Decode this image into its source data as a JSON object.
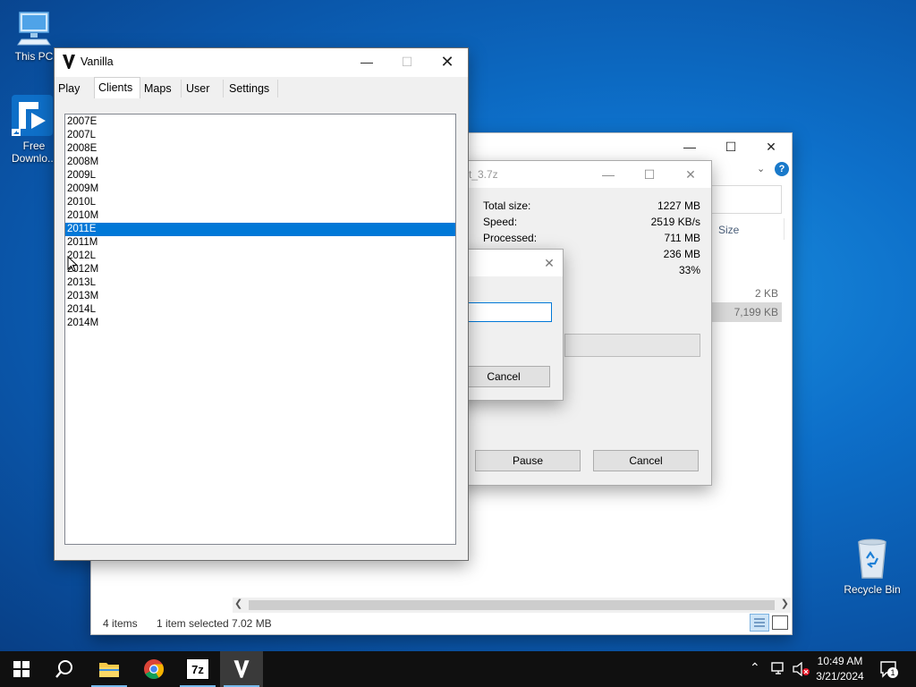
{
  "desktop": {
    "icons": [
      {
        "label": "This PC"
      },
      {
        "label": "Free Downlo..."
      },
      {
        "label": "Recycle Bin"
      }
    ]
  },
  "explorer": {
    "column_size": "Size",
    "file_sizes": [
      "2 KB",
      "7,199 KB"
    ],
    "status": {
      "items": "4 items",
      "selected": "1 item selected",
      "size": "7.02 MB"
    }
  },
  "extract_dialog": {
    "title_fragment": "rt_3.7z",
    "stats": [
      {
        "label": "Total size:",
        "value": "1227 MB"
      },
      {
        "label": "Speed:",
        "value": "2519 KB/s"
      },
      {
        "label": "Processed:",
        "value": "711 MB"
      },
      {
        "label": "",
        "value": "236 MB"
      },
      {
        "label": "",
        "value": "33%"
      }
    ],
    "pause_label": "Pause",
    "cancel_label": "Cancel"
  },
  "small_dialog": {
    "cancel_label": "Cancel",
    "input_value": ""
  },
  "vanilla": {
    "title": "Vanilla",
    "tabs": [
      {
        "label": "Play"
      },
      {
        "label": "Clients"
      },
      {
        "label": "Maps"
      },
      {
        "label": "User"
      },
      {
        "label": "Settings"
      }
    ],
    "active_tab": "Clients",
    "clients": [
      "2007E",
      "2007L",
      "2008E",
      "2008M",
      "2009L",
      "2009M",
      "2010L",
      "2010M",
      "2011E",
      "2011M",
      "2012L",
      "2012M",
      "2013L",
      "2013M",
      "2014L",
      "2014M"
    ],
    "selected_client": "2011E"
  },
  "taskbar": {
    "time": "10:49 AM",
    "date": "3/21/2024",
    "notification_count": "1",
    "apps": [
      "start",
      "search",
      "file-explorer",
      "chrome",
      "7-zip",
      "vanilla"
    ]
  },
  "colors": {
    "selection": "#0078d7",
    "taskbar": "#101010"
  }
}
